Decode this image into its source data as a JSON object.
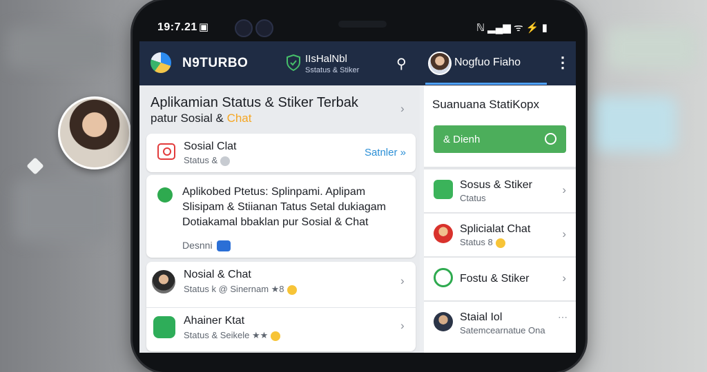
{
  "statusbar": {
    "time": "19:7.21",
    "right_icons": "ℕ ▂▄▆ ᯤ ⚡ ▮"
  },
  "appbar": {
    "brand": "N9TURBO",
    "tab_title": "IIsHalNbl",
    "tab_subtitle": "Sstatus & Stiker",
    "username": "Nogfuo Fiaho"
  },
  "left": {
    "hero_title": "Aplikamian Status & Stiker Terbak",
    "hero_sub_plain": "patur Sosial &",
    "hero_sub_accent": "Chat",
    "card1": {
      "title": "Sosial Clat",
      "subtitle": "Status &",
      "action": "Satnler »"
    },
    "card2": {
      "body": "Aplikobed Ptetus: Splinpami. Aplipam Slisipam & Stiianan Tatus Setal dukiagam Dotiakamal bbaklan pur Sosial & Chat",
      "footer": "Desnni"
    },
    "list": [
      {
        "title": "Nosial & Chat",
        "subtitle": "Status k @ Sinernam ★8"
      },
      {
        "title": "Ahainer Ktat",
        "subtitle": "Status & Seikele ★★"
      }
    ]
  },
  "right": {
    "panel_title": "Suanuana StatiKopx",
    "button_label": "& Dienh",
    "items": [
      {
        "title": "Sosus & Stiker",
        "subtitle": "Ctatus"
      },
      {
        "title": "Splicialat Chat",
        "subtitle": "Status 8"
      },
      {
        "title": "Fostu & Stiker",
        "subtitle": ""
      },
      {
        "title": "Staial Iol",
        "subtitle": "Satemcearnatue Ona"
      }
    ]
  },
  "colors": {
    "appbar": "#1f2c44",
    "accent_green": "#4cae5b",
    "accent_orange": "#f5a623",
    "link_blue": "#2b8fd6"
  }
}
